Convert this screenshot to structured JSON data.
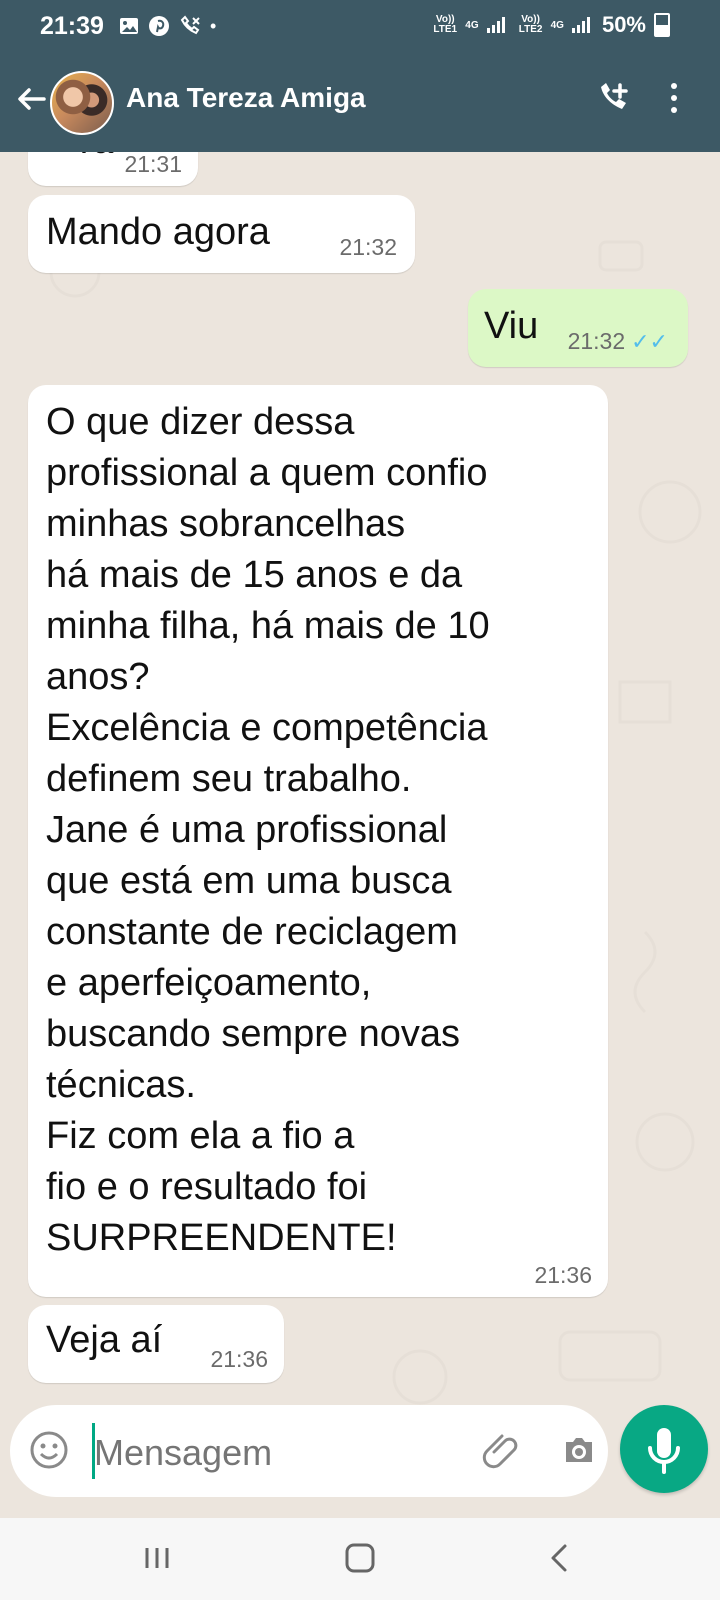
{
  "status_bar": {
    "time": "21:39",
    "left_icons": [
      "image-icon",
      "pinterest-icon",
      "no-call-icon"
    ],
    "dot": "•",
    "lte1": "Vo)) LTE1",
    "lte2": "Vo)) LTE2",
    "network": "4G",
    "battery": "50%"
  },
  "app_bar": {
    "contact_name": "Ana Tereza Amiga"
  },
  "messages": [
    {
      "text": "Ya",
      "time": "21:31",
      "direction": "in"
    },
    {
      "text": "Mando agora",
      "time": "21:32",
      "direction": "in"
    },
    {
      "text": "Viu",
      "time": "21:32",
      "direction": "out",
      "status": "read"
    },
    {
      "text": "O que dizer dessa\nprofissional a quem confio\nminhas sobrancelhas\nhá mais de 15 anos e da\nminha filha, há mais de 10\nanos?\nExcelência e competência\ndefinem seu trabalho.\nJane é uma profissional\nque está em uma busca\nconstante de reciclagem\ne aperfeiçoamento,\nbuscando sempre novas\ntécnicas.\nFiz com ela a fio a\nfio e o resultado foi\nSURPREENDENTE!",
      "time": "21:36",
      "direction": "in"
    },
    {
      "text": "Veja aí",
      "time": "21:36",
      "direction": "in"
    }
  ],
  "composer": {
    "placeholder": "Mensagem"
  },
  "colors": {
    "header": "#3d5965",
    "chat_bg": "#ece5dd",
    "outgoing_bubble": "#dcf8c6",
    "accent": "#08a884",
    "read_ticks": "#53bdeb"
  }
}
